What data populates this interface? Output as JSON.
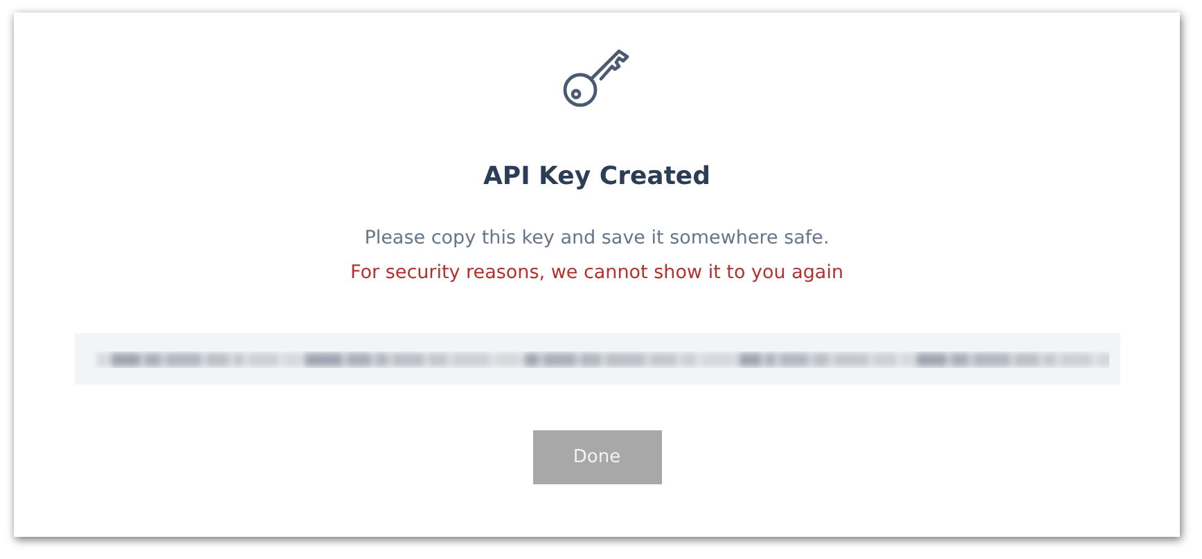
{
  "dialog": {
    "title": "API Key Created",
    "message": "Please copy this key and save it somewhere safe.",
    "warning": "For security reasons, we cannot show it to you again",
    "key_field": {
      "redacted": true
    },
    "buttons": [
      {
        "label": "Done",
        "disabled": true
      }
    ]
  }
}
